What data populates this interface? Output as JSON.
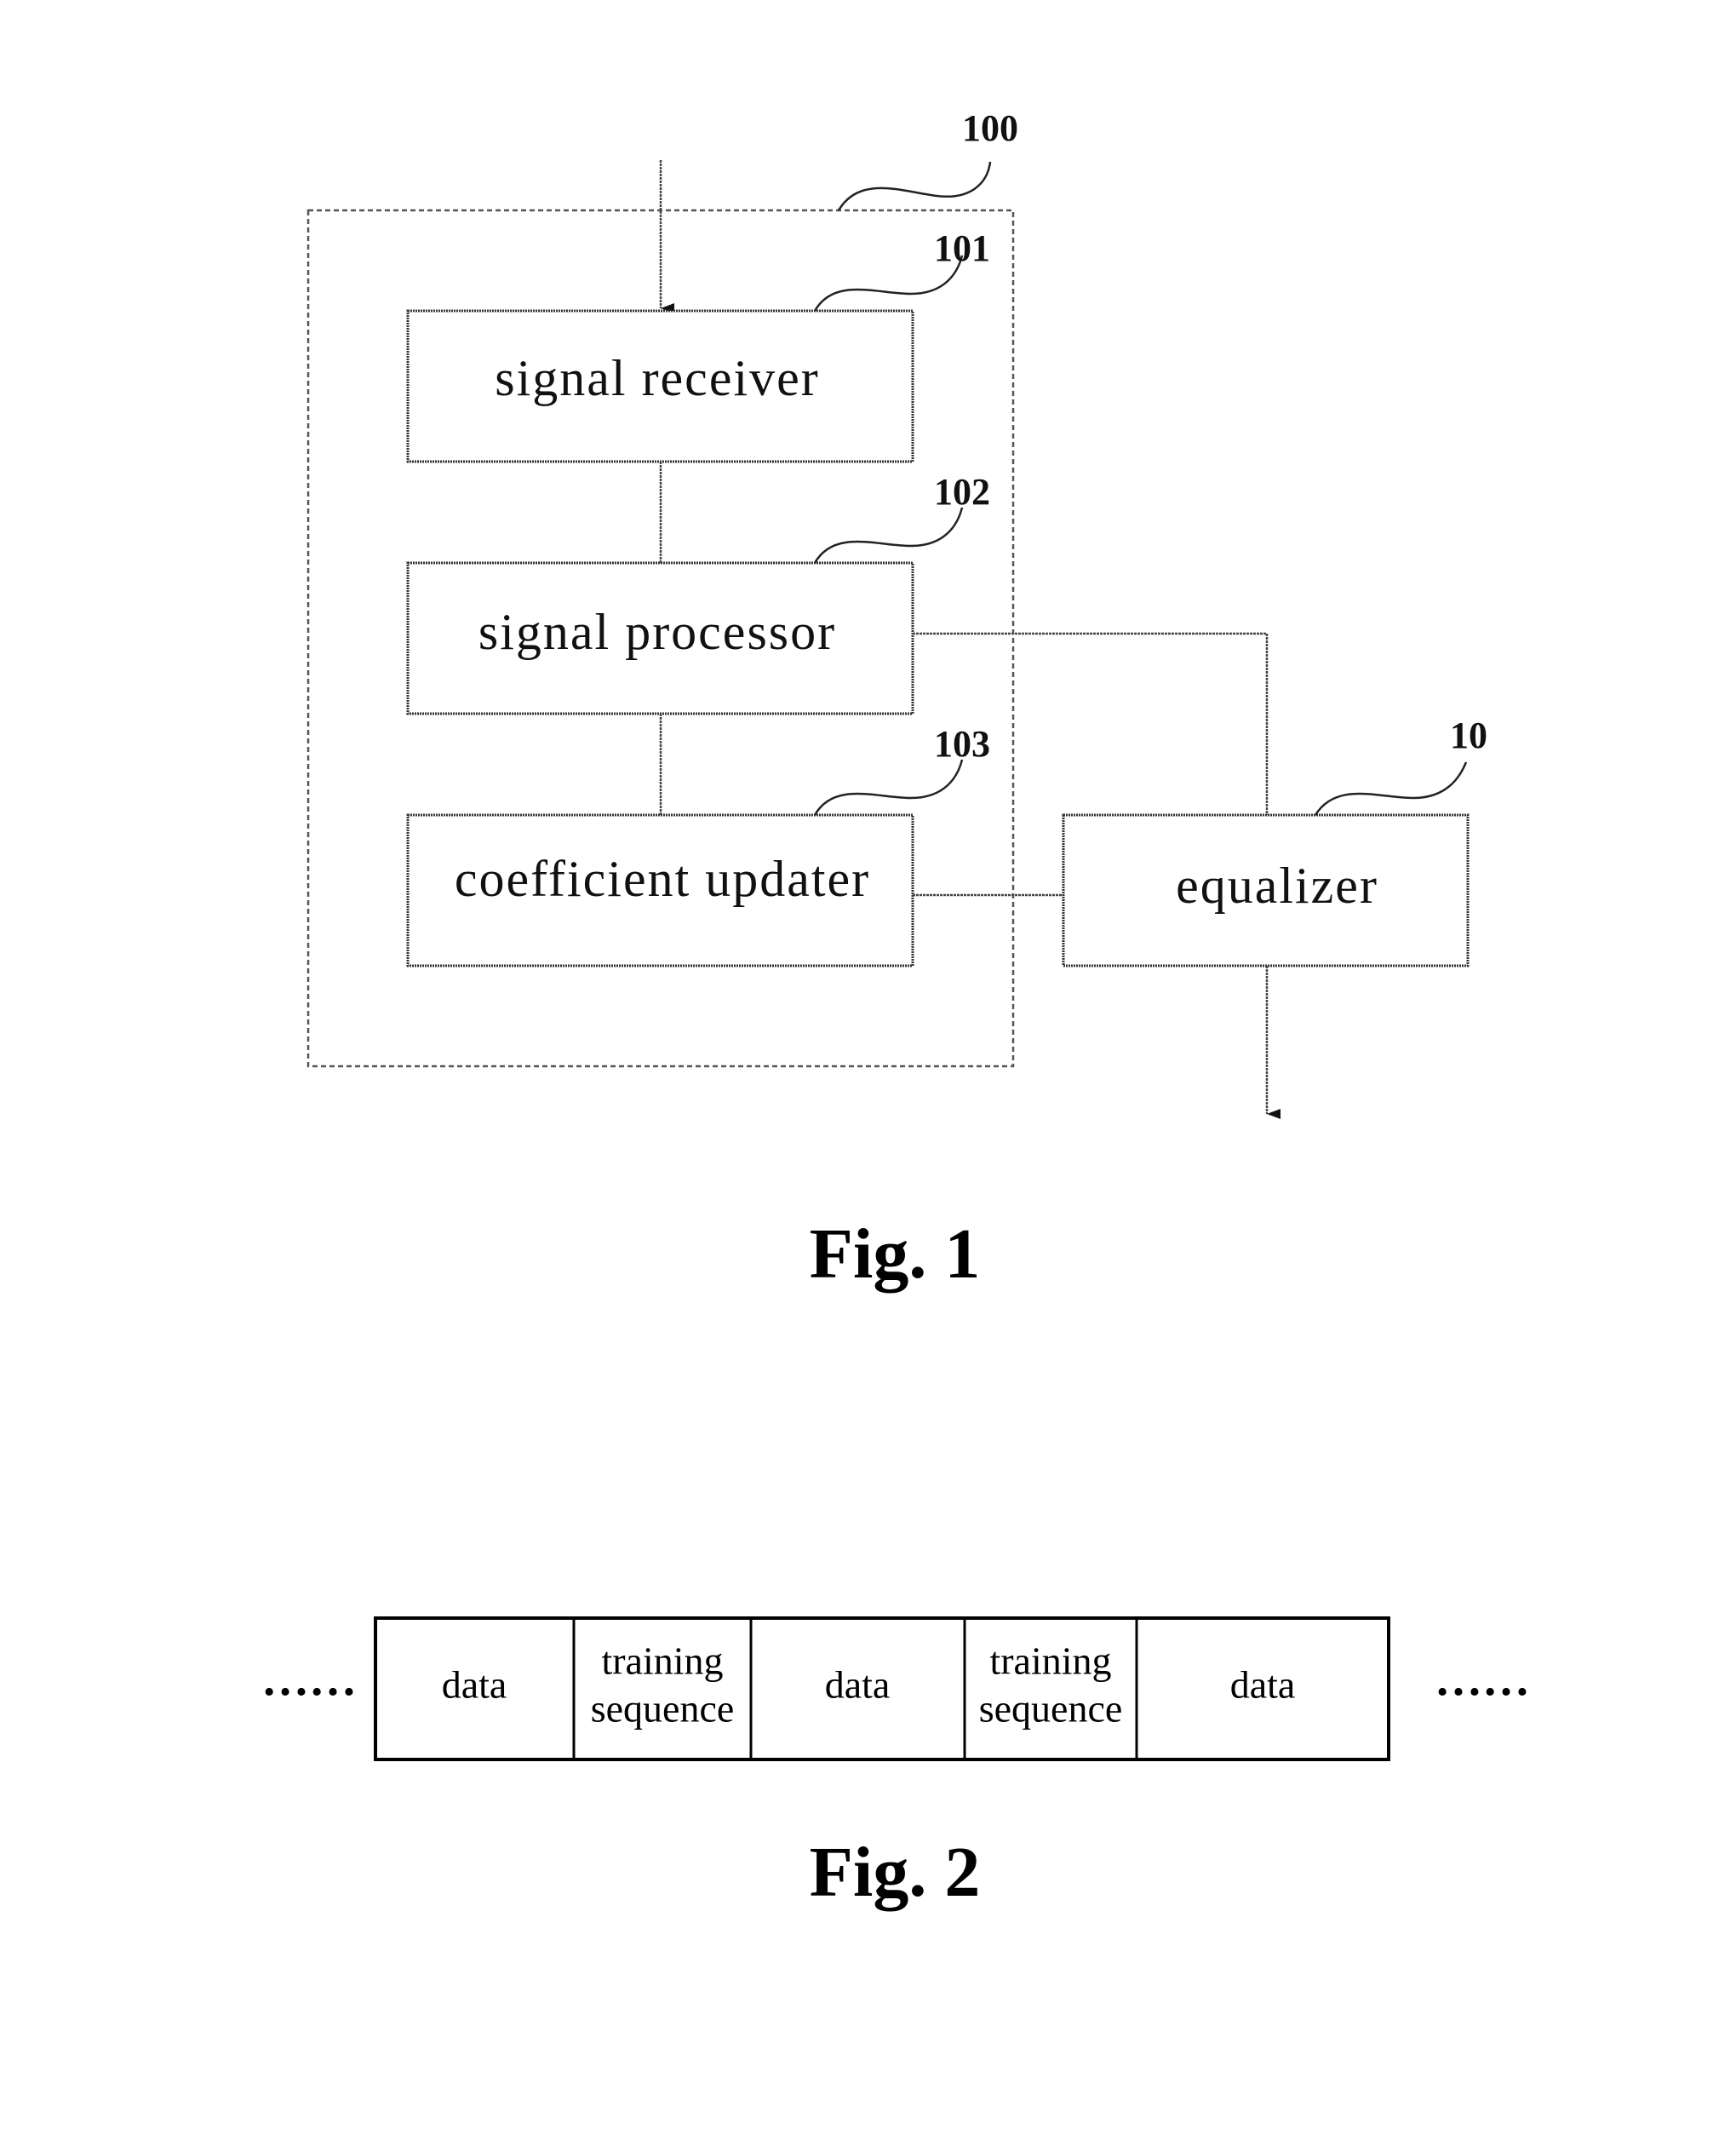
{
  "figure1": {
    "caption": "Fig. 1",
    "container_ref": "100",
    "blocks": [
      {
        "ref": "101",
        "label": "signal receiver"
      },
      {
        "ref": "102",
        "label": "signal processor"
      },
      {
        "ref": "103",
        "label": "coefficient updater"
      }
    ],
    "equalizer": {
      "ref": "10",
      "label": "equalizer"
    }
  },
  "figure2": {
    "caption": "Fig. 2",
    "leading_ellipsis": "……",
    "trailing_ellipsis": "……",
    "cells": [
      {
        "lines": [
          "data"
        ]
      },
      {
        "lines": [
          "training",
          "sequence"
        ]
      },
      {
        "lines": [
          "data"
        ]
      },
      {
        "lines": [
          "training",
          "sequence"
        ]
      },
      {
        "lines": [
          "data"
        ]
      }
    ]
  }
}
